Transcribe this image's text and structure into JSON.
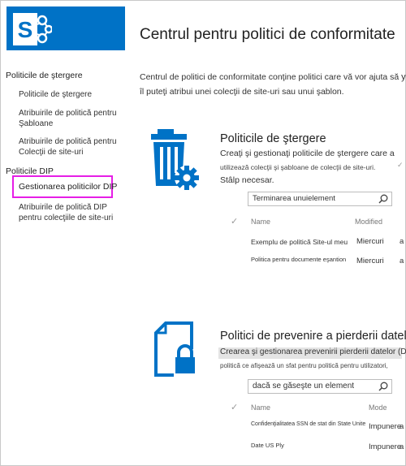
{
  "header": {
    "page_title": "Centrul pentru politici de conformitate"
  },
  "nav": {
    "retention_head": "Politicile de ştergere",
    "retention_items": [
      "Politicile de ştergere",
      "Atribuirile de politică pentru",
      "Şabloane",
      "Atribuirile de politică pentru",
      "Colecţii de site-uri"
    ],
    "dlp_head": "Politicile DIP",
    "dlp_manage": "Gestionarea politicilor DIP",
    "dlp_assign_1": "Atribuirile de politică DIP",
    "dlp_assign_2": "pentru colecţiile de site-uri"
  },
  "intro": {
    "line1": "Centrul de politici de conformitate conţine politici care vă vor ajuta să",
    "line1_tail": "yo",
    "line2": "îl puteţi atribui unei colecţii de site-uri sau unui şablon."
  },
  "deletion": {
    "title": "Politicile de ştergere",
    "desc1": "Creaţi şi gestionaţi politicile de ştergere care a",
    "desc2": "utilizează colecţii şi şabloane de colecţii de site-uri.",
    "desc3": "Stâlp necesar.",
    "search_placeholder": "Terminarea unuielement",
    "col_name": "Name",
    "col_modified": "Modified",
    "rows": [
      {
        "name": "Exemplu de politică Site-ul meu",
        "value": "Miercuri",
        "tail": "a"
      },
      {
        "name": "Politica pentru documente eşantion",
        "value": "Miercuri",
        "tail": "a"
      }
    ]
  },
  "dlp": {
    "title": "Politici de prevenire a pierderii datelor",
    "desc1": "Crearea şi gestionarea prevenirii pierderii datelor (D",
    "desc2": "politică ce afişează un sfat pentru politică pentru utilizatori,",
    "search_placeholder": "dacă se găseşte un element",
    "col_name": "Name",
    "col_mode": "Mode",
    "rows": [
      {
        "name": "Confidenţialitatea SSN de stat din State Unite",
        "value": "Impunere",
        "tail": "a"
      },
      {
        "name": "Date US Ply",
        "value": "Impunere",
        "tail": "a"
      }
    ]
  },
  "colors": {
    "brand": "#0072c6",
    "selection_outline": "#e61ee6"
  },
  "icons": [
    "sharepoint-logo-icon",
    "trash-gear-icon",
    "document-lock-icon",
    "search-icon",
    "checkmark-icon"
  ]
}
